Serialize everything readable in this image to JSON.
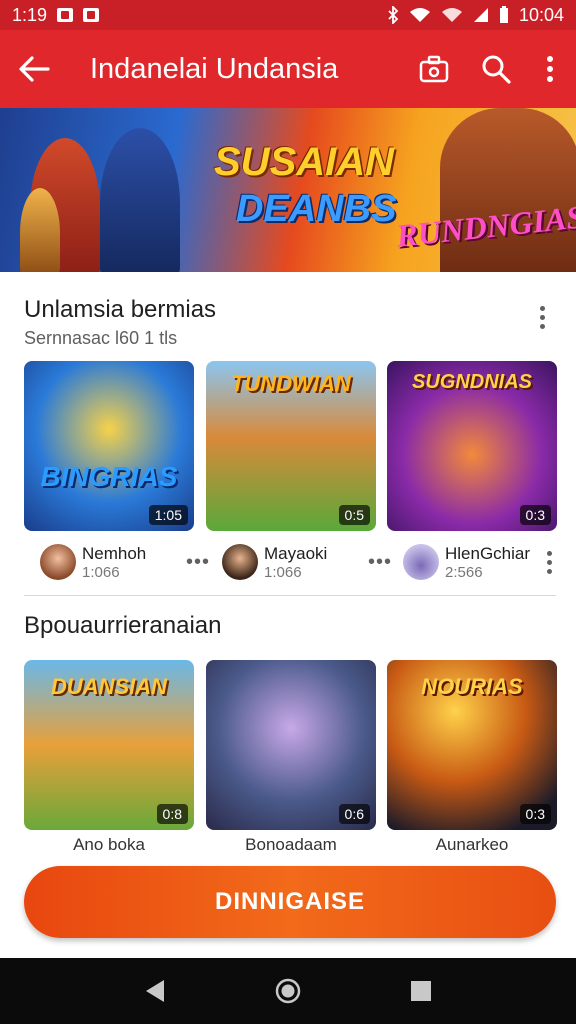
{
  "status_bar": {
    "time_left": "1:19",
    "time_right": "10:04"
  },
  "app_bar": {
    "title": "Indanelai Undansia"
  },
  "banner": {
    "title_line1": "SUSAIAN",
    "title_line2": "DEANBS",
    "title_right": "RUNDNGIAS"
  },
  "section1": {
    "title": "Unlamsia bermias",
    "subtitle": "Sernnasac l60 1 tls",
    "cards": [
      {
        "art_title": "BINGRIAS",
        "badge": "1:05",
        "name": "Nemhoh",
        "count": "1:066"
      },
      {
        "art_title": "TUNDWIAN",
        "badge": "0:5",
        "name": "Mayaoki",
        "count": "1:066"
      },
      {
        "art_title": "SUGNDNIAS",
        "badge": "0:3",
        "name": "HlenGchiar",
        "count": "2:566"
      }
    ]
  },
  "section2": {
    "title": "Bpouaurrieranaian",
    "cards": [
      {
        "art_title": "DUANSIAN",
        "badge": "0:8",
        "caption": "Ano boka"
      },
      {
        "art_title": "",
        "badge": "0:6",
        "caption": "Bonoadaam"
      },
      {
        "art_title": "NOURIAS",
        "badge": "0:3",
        "caption": "Aunarkeo"
      }
    ]
  },
  "cta": {
    "label": "DINNIGAISE"
  },
  "colors": {
    "app_bar": "#e0282c",
    "status_bar": "#c91f27",
    "cta": "#f26a1a"
  }
}
